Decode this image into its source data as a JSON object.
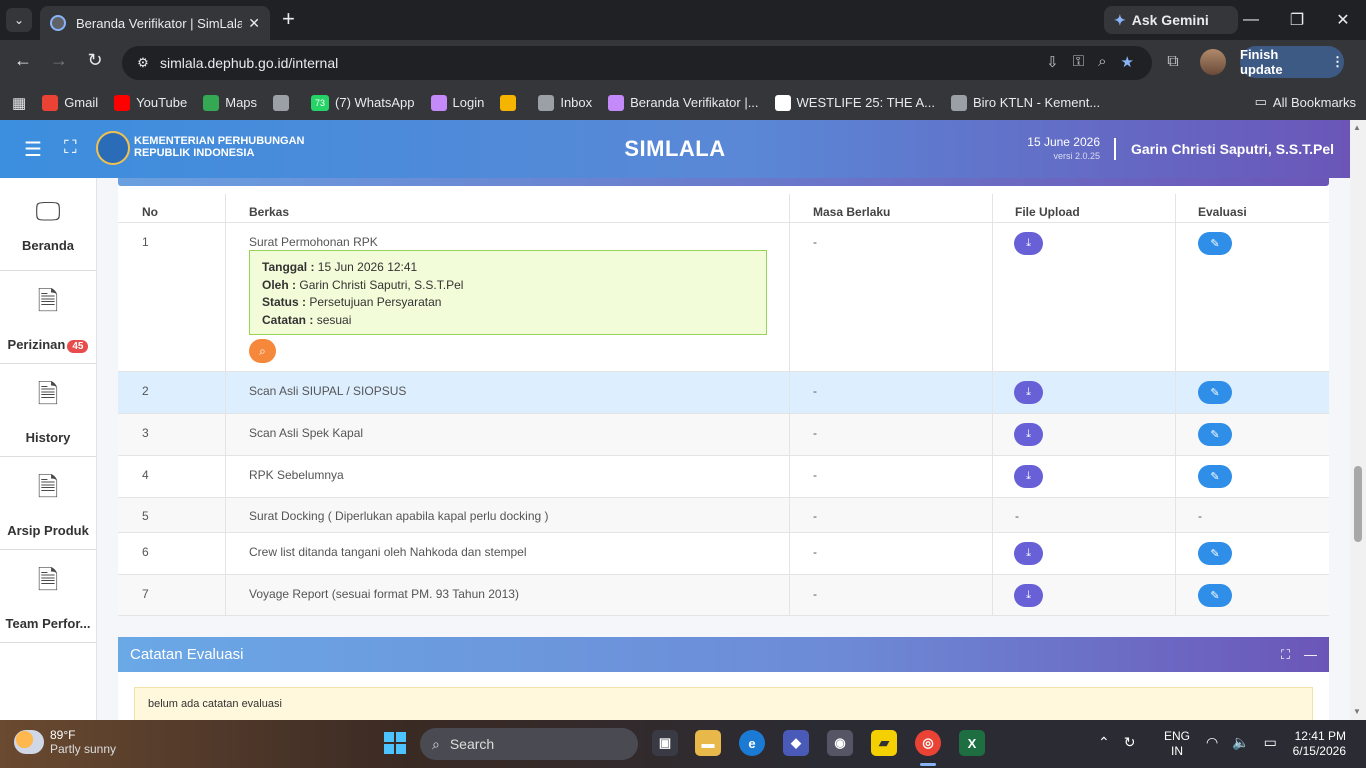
{
  "browser": {
    "tab_title": "Beranda Verifikator | SimLala",
    "url": "simlala.dephub.go.id/internal",
    "ask_gemini": "Ask Gemini",
    "finish_update": "Finish update",
    "bookmarks": [
      {
        "label": "Gmail",
        "icon": "gmail-icon",
        "color": "#ea4335"
      },
      {
        "label": "YouTube",
        "icon": "youtube-icon",
        "color": "#ff0000"
      },
      {
        "label": "Maps",
        "icon": "maps-icon",
        "color": "#34a853"
      },
      {
        "label": "",
        "icon": "globe-icon",
        "color": "#9aa0a6"
      },
      {
        "label": "(7) WhatsApp",
        "icon": "whatsapp-icon",
        "color": "#25d366",
        "badge": "73"
      },
      {
        "label": "Login",
        "icon": "login-icon",
        "color": "#c58af9"
      },
      {
        "label": "",
        "icon": "pinwheel-icon",
        "color": "#f4b400"
      },
      {
        "label": "Inbox",
        "icon": "inbox-icon",
        "color": "#9aa0a6"
      },
      {
        "label": "Beranda Verifikator |...",
        "icon": "ministry-icon",
        "color": "#c58af9"
      },
      {
        "label": "WESTLIFE 25: THE A...",
        "icon": "ticket-icon",
        "color": "#ffffff"
      },
      {
        "label": "Biro KTLN - Kement...",
        "icon": "globe-icon",
        "color": "#9aa0a6"
      }
    ],
    "all_bookmarks": "All Bookmarks"
  },
  "header": {
    "ministry_line1": "KEMENTERIAN PERHUBUNGAN",
    "ministry_line2": "REPUBLIK INDONESIA",
    "app_title": "SIMLALA",
    "date": "15 June 2026",
    "version": "versi 2.0.25",
    "user": "Garin Christi Saputri, S.S.T.Pel"
  },
  "sidebar": {
    "items": [
      {
        "label": "Beranda",
        "icon": "monitor-icon"
      },
      {
        "label": "Perizinan",
        "icon": "document-icon",
        "badge": "45"
      },
      {
        "label": "History",
        "icon": "document-icon"
      },
      {
        "label": "Arsip Produk",
        "icon": "document-icon"
      },
      {
        "label": "Team Perfor...",
        "icon": "document-icon"
      }
    ]
  },
  "table": {
    "headers": {
      "no": "No",
      "berkas": "Berkas",
      "masa": "Masa Berlaku",
      "upload": "File Upload",
      "evaluasi": "Evaluasi"
    },
    "rows": [
      {
        "no": "1",
        "berkas": "Surat Permohonan RPK",
        "masa": "-",
        "upload": "download",
        "evaluasi": "edit"
      },
      {
        "no": "2",
        "berkas": "Scan Asli SIUPAL / SIOPSUS",
        "masa": "-",
        "upload": "download",
        "evaluasi": "edit"
      },
      {
        "no": "3",
        "berkas": "Scan Asli Spek Kapal",
        "masa": "-",
        "upload": "download",
        "evaluasi": "edit"
      },
      {
        "no": "4",
        "berkas": "RPK Sebelumnya",
        "masa": "-",
        "upload": "download",
        "evaluasi": "edit"
      },
      {
        "no": "5",
        "berkas": "Surat Docking ( Diperlukan apabila kapal perlu docking )",
        "masa": "-",
        "upload": "-",
        "evaluasi": "-"
      },
      {
        "no": "6",
        "berkas": "Crew list ditanda tangani oleh Nahkoda dan stempel",
        "masa": "-",
        "upload": "download",
        "evaluasi": "edit"
      },
      {
        "no": "7",
        "berkas": "Voyage Report (sesuai format PM. 93 Tahun 2013)",
        "masa": "-",
        "upload": "download",
        "evaluasi": "edit"
      }
    ],
    "verification": {
      "tanggal_label": "Tanggal :",
      "tanggal": "15 Jun 2026 12:41",
      "oleh_label": "Oleh :",
      "oleh": "Garin Christi Saputri, S.S.T.Pel",
      "status_label": "Status :",
      "status": "Persetujuan Persyaratan",
      "catatan_label": "Catatan :",
      "catatan": "sesuai"
    }
  },
  "evaluation": {
    "title": "Catatan Evaluasi",
    "empty_note": "belum ada catatan evaluasi"
  },
  "taskbar": {
    "temperature": "89°F",
    "weather": "Partly sunny",
    "search": "Search",
    "lang1": "ENG",
    "lang2": "IN",
    "time": "12:41 PM",
    "date": "6/15/2026"
  }
}
